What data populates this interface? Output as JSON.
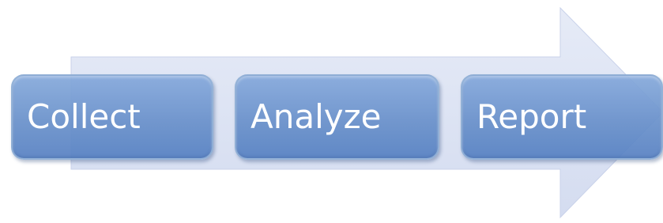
{
  "diagram": {
    "steps": [
      {
        "label": "Collect"
      },
      {
        "label": "Analyze"
      },
      {
        "label": "Report"
      }
    ],
    "colors": {
      "arrow_fill": "#dde3f3",
      "box_fill": "#7fa2d8",
      "box_border": "#9cb8dc",
      "text": "#ffffff"
    }
  }
}
